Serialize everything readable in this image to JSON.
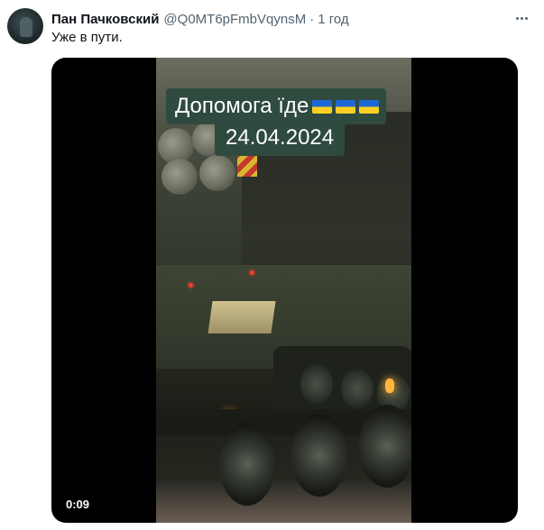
{
  "tweet": {
    "author_name": "Пан Пачковский",
    "handle": "@Q0MT6pFmbVqynsM",
    "separator": "·",
    "time": "1 год",
    "text": "Уже в пути."
  },
  "video": {
    "caption_line1": "Допомога їде",
    "caption_flags": [
      "ukraine-flag-icon",
      "ukraine-flag-icon",
      "ukraine-flag-icon"
    ],
    "caption_line2": "24.04.2024",
    "timestamp": "0:09"
  },
  "colors": {
    "name_text": "#0f1419",
    "secondary_text": "#536471",
    "caption_bg": "#2f4a3f",
    "media_bg": "#000000"
  }
}
